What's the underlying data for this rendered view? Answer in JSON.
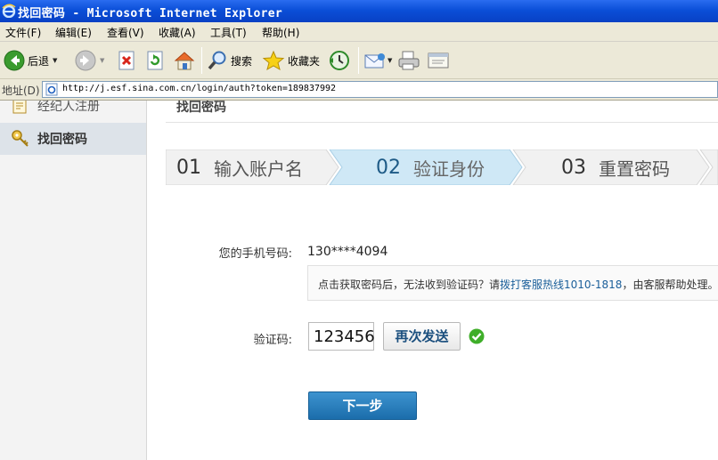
{
  "window": {
    "title": "找回密码 - Microsoft Internet Explorer"
  },
  "menu": {
    "file": "文件(F)",
    "edit": "编辑(E)",
    "view": "查看(V)",
    "favorites": "收藏(A)",
    "tools": "工具(T)",
    "help": "帮助(H)"
  },
  "toolbar": {
    "back": "后退",
    "search": "搜索",
    "favorites": "收藏夹"
  },
  "address": {
    "label": "地址(D)",
    "url": "http://j.esf.sina.com.cn/login/auth?token=189837992"
  },
  "sidebar": {
    "items": [
      {
        "label": "经纪人注册"
      },
      {
        "label": "找回密码"
      }
    ]
  },
  "content": {
    "header": "找回密码"
  },
  "steps": [
    {
      "num": "01",
      "label": "输入账户名"
    },
    {
      "num": "02",
      "label": "验证身份"
    },
    {
      "num": "03",
      "label": "重置密码"
    }
  ],
  "form": {
    "phone_label": "您的手机号码:",
    "phone_value": "130****4094",
    "tip_prefix": "点击获取密码后，无法收到验证码？请",
    "tip_link": "拨打客服热线1010-1818",
    "tip_suffix": "，由客服帮助处理。",
    "code_label": "验证码:",
    "code_value": "123456",
    "resend_label": "再次发送",
    "next_label": "下一步"
  },
  "colors": {
    "titlebar": "#0b4fd8",
    "chrome": "#ece9d8",
    "active_step": "#cfe8f6",
    "primary_button": "#1f72b0",
    "success": "#3fae29"
  }
}
